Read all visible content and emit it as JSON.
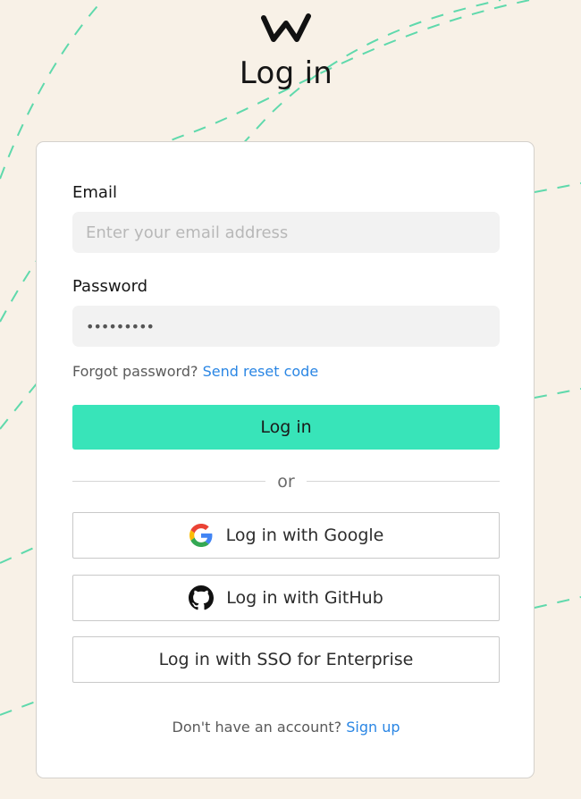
{
  "page": {
    "title": "Log in"
  },
  "form": {
    "email_label": "Email",
    "email_placeholder": "Enter your email address",
    "email_value": "",
    "password_label": "Password",
    "password_value": "•••••••••",
    "forgot_text": "Forgot password?",
    "reset_link": "Send reset code",
    "submit_label": "Log in",
    "divider_text": "or"
  },
  "oauth": {
    "google_label": "Log in with Google",
    "github_label": "Log in with GitHub",
    "sso_label": "Log in with SSO for Enterprise"
  },
  "footer": {
    "prompt": "Don't have an account?",
    "signup_link": "Sign up"
  },
  "colors": {
    "background": "#f8f1e7",
    "accent": "#38e4b9",
    "link": "#2a86e4",
    "dashed_lines": "#5fd9ac"
  },
  "icons": {
    "logo": "brand-w-logo",
    "google": "google-g-icon",
    "github": "github-octocat-icon"
  }
}
